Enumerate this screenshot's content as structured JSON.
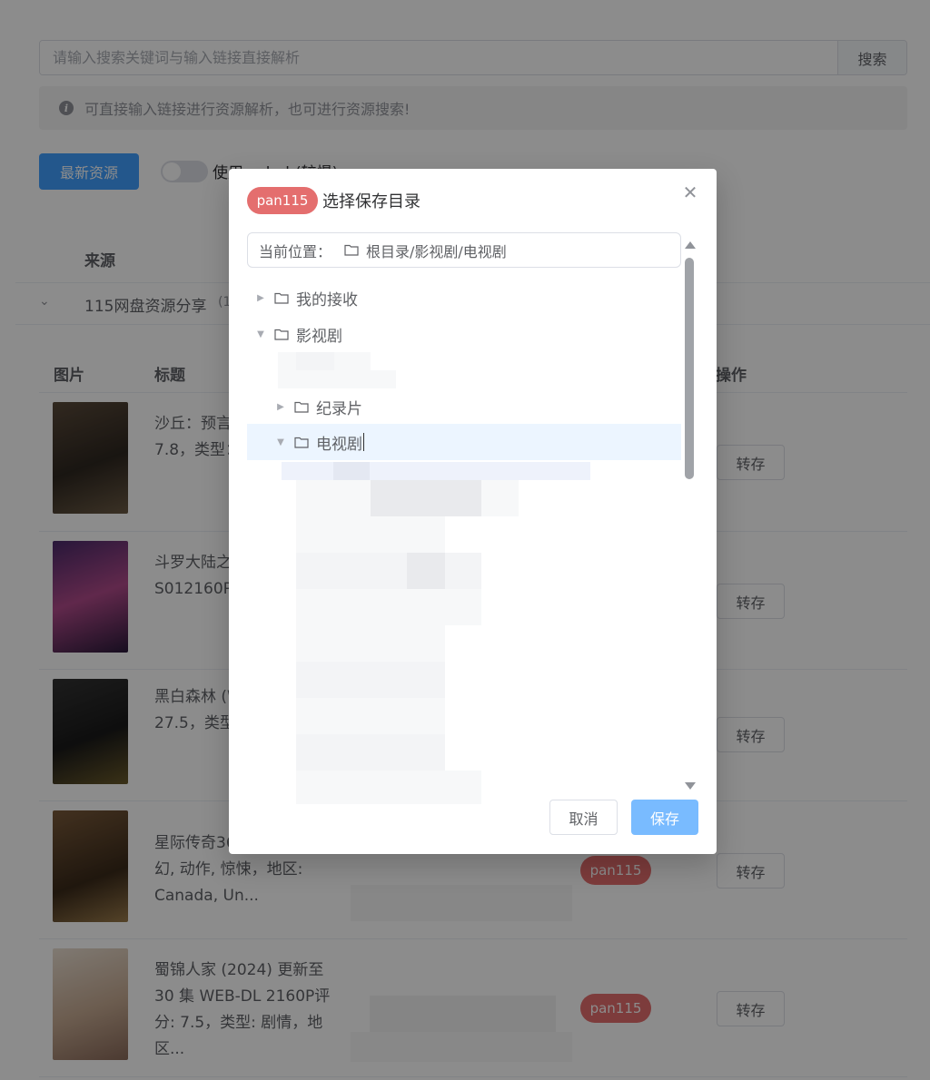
{
  "search": {
    "placeholder": "请输入搜索关键词与输入链接直接解析",
    "button_label": "搜索"
  },
  "hint": {
    "icon": "info-icon",
    "text": "可直接输入链接进行资源解析，也可进行资源搜索!"
  },
  "toolbar": {
    "latest_label": "最新资源",
    "toggle_label": "使用rsshub(较慢)"
  },
  "table": {
    "source_header": "来源",
    "group": {
      "name": "115网盘资源分享",
      "count": "(1"
    },
    "headers": {
      "image": "图片",
      "title": "标题",
      "operation": "操作"
    },
    "rows": [
      {
        "title": "沙丘：预言视界 更新至7.8，类型：Fanta...",
        "tag": "",
        "action": "转存"
      },
      {
        "title": "斗罗大陆之(2024) S012160P评分剧情, S...",
        "tag": "",
        "action": "转存"
      },
      {
        "title": "黑白森林 (WEB-DL 27.5，类型:地...",
        "tag": "",
        "action": "转存"
      },
      {
        "title": "星际传奇36.3，类型: 科幻, 动作, 惊悚，地区: Canada, Un...",
        "tag": "pan115",
        "action": "转存"
      },
      {
        "title": "蜀锦人家 (2024) 更新至30 集 WEB-DL 2160P评分: 7.5，类型: 剧情，地区...",
        "tag": "pan115",
        "action": "转存"
      }
    ]
  },
  "dialog": {
    "tag": "pan115",
    "title": "选择保存目录",
    "close_icon": "close-icon",
    "location_label": "当前位置：",
    "location_path": "根目录/影视剧/电视剧",
    "tree": [
      {
        "label": "我的接收",
        "expanded": false
      },
      {
        "label": "影视剧",
        "expanded": true
      },
      {
        "label": "纪录片",
        "expanded": false
      },
      {
        "label": "电视剧",
        "expanded": true,
        "selected": true
      }
    ],
    "cancel_label": "取消",
    "save_label": "保存"
  },
  "colors": {
    "primary": "#409eff",
    "save_button": "#79bbff",
    "tag_red": "#e46e6e",
    "selected_row": "#ecf5ff",
    "overlay": "rgba(0,0,0,0.45)"
  }
}
